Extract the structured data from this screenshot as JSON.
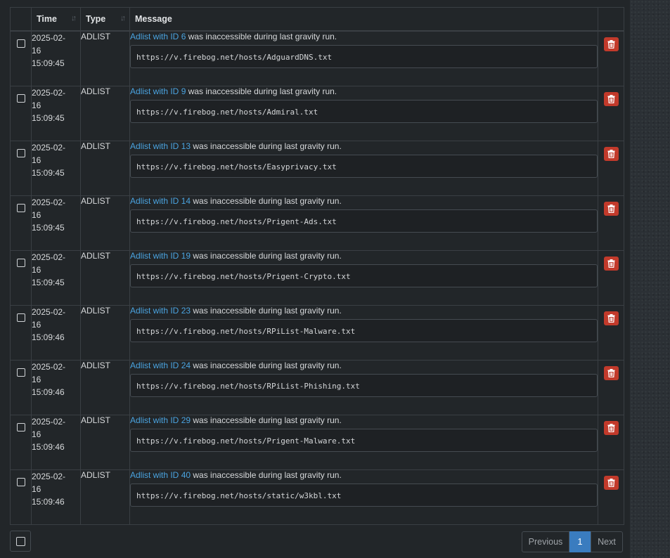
{
  "table": {
    "headers": {
      "time": "Time",
      "type": "Type",
      "message": "Message"
    },
    "link_prefix": "Adlist with ID ",
    "message_suffix": " was inaccessible during last gravity run.",
    "rows": [
      {
        "date": "2025-02-",
        "day": "16",
        "clock": "15:09:45",
        "type": "ADLIST",
        "id": "6",
        "url": "https://v.firebog.net/hosts/AdguardDNS.txt"
      },
      {
        "date": "2025-02-",
        "day": "16",
        "clock": "15:09:45",
        "type": "ADLIST",
        "id": "9",
        "url": "https://v.firebog.net/hosts/Admiral.txt"
      },
      {
        "date": "2025-02-",
        "day": "16",
        "clock": "15:09:45",
        "type": "ADLIST",
        "id": "13",
        "url": "https://v.firebog.net/hosts/Easyprivacy.txt"
      },
      {
        "date": "2025-02-",
        "day": "16",
        "clock": "15:09:45",
        "type": "ADLIST",
        "id": "14",
        "url": "https://v.firebog.net/hosts/Prigent-Ads.txt"
      },
      {
        "date": "2025-02-",
        "day": "16",
        "clock": "15:09:45",
        "type": "ADLIST",
        "id": "19",
        "url": "https://v.firebog.net/hosts/Prigent-Crypto.txt"
      },
      {
        "date": "2025-02-",
        "day": "16",
        "clock": "15:09:46",
        "type": "ADLIST",
        "id": "23",
        "url": "https://v.firebog.net/hosts/RPiList-Malware.txt"
      },
      {
        "date": "2025-02-",
        "day": "16",
        "clock": "15:09:46",
        "type": "ADLIST",
        "id": "24",
        "url": "https://v.firebog.net/hosts/RPiList-Phishing.txt"
      },
      {
        "date": "2025-02-",
        "day": "16",
        "clock": "15:09:46",
        "type": "ADLIST",
        "id": "29",
        "url": "https://v.firebog.net/hosts/Prigent-Malware.txt"
      },
      {
        "date": "2025-02-",
        "day": "16",
        "clock": "15:09:46",
        "type": "ADLIST",
        "id": "40",
        "url": "https://v.firebog.net/hosts/static/w3kbl.txt"
      }
    ]
  },
  "pagination": {
    "previous_label": "Previous",
    "current_page": "1",
    "next_label": "Next"
  },
  "icons": {
    "delete": "trash-icon",
    "sort": "sort-icon"
  },
  "colors": {
    "link": "#4aa3df",
    "delete_button": "#c23a2b",
    "active_page": "#3a7cbf"
  }
}
